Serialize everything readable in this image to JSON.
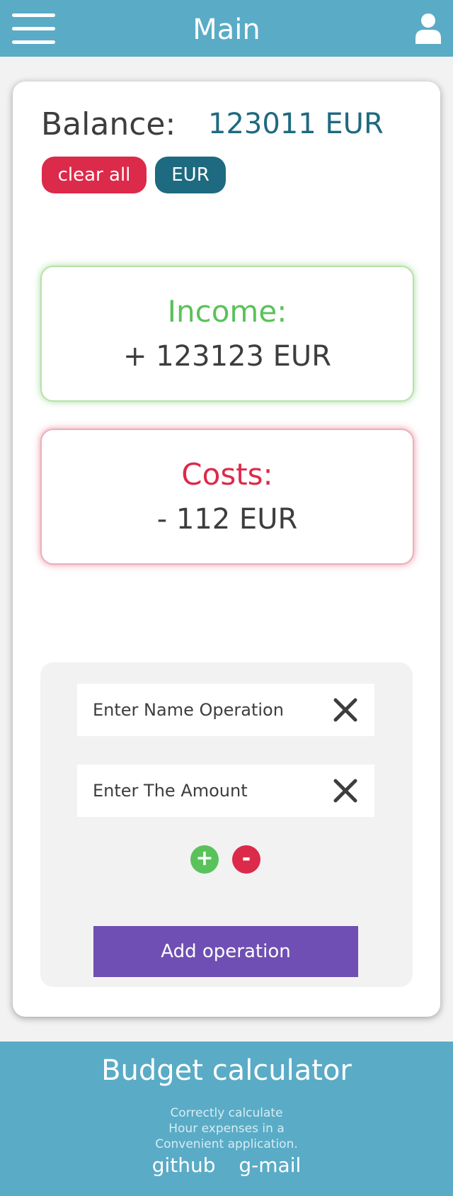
{
  "header": {
    "title": "Main",
    "menu_icon": "hamburger-menu-icon",
    "user_icon": "user-icon"
  },
  "balance": {
    "label": "Balance:",
    "value": "123011 EUR",
    "clear_label": "clear all",
    "currency_label": "EUR"
  },
  "income": {
    "label": "Income:",
    "value": "+ 123123 EUR"
  },
  "costs": {
    "label": "Costs:",
    "value": "- 112 EUR"
  },
  "form": {
    "name_placeholder": "Enter Name Operation",
    "name_value": "",
    "amount_placeholder": "Enter The Amount",
    "amount_value": "",
    "clear_icon": "close-icon",
    "plus_label": "+",
    "minus_label": "-",
    "submit_label": "Add operation"
  },
  "footer": {
    "title": "Budget calculator",
    "description": [
      "Correctly calculate",
      "Hour expenses in a",
      "Convenient application."
    ],
    "links": [
      "github",
      "g-mail"
    ]
  },
  "colors": {
    "header_bg": "#5aabc6",
    "accent_dark": "#1e6a80",
    "danger": "#dc2a4a",
    "success": "#5ac25a",
    "primary_button": "#6f4fb3"
  }
}
